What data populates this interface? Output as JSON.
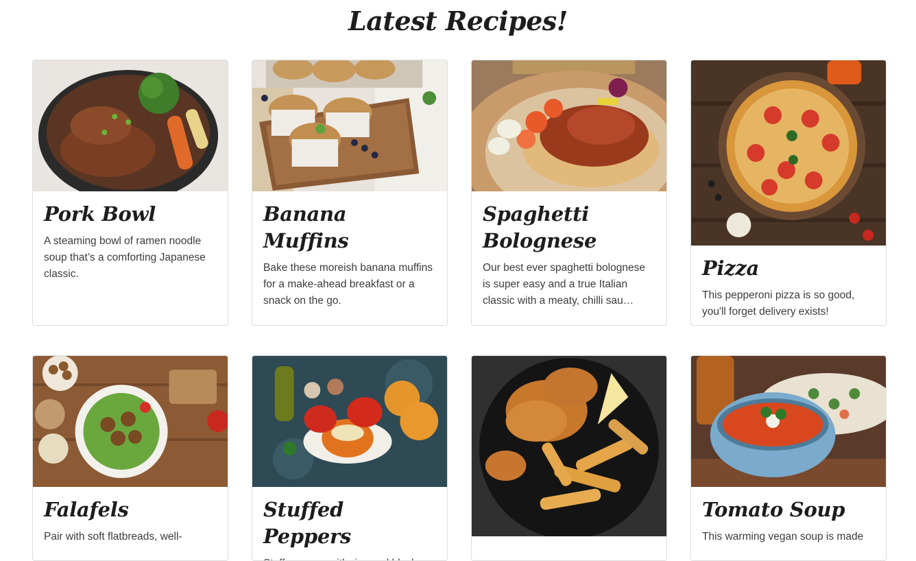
{
  "page": {
    "title": "Latest Recipes!"
  },
  "recipes": [
    {
      "title": "Pork Bowl",
      "description": "A steaming bowl of ramen noodle soup that’s a comforting Japanese classic.",
      "image": "pork-bowl-photo"
    },
    {
      "title": "Banana Muffins",
      "description": "Bake these moreish banana muffins for a make-ahead breakfast or a snack on the go.",
      "image": "banana-muffins-photo"
    },
    {
      "title": "Spaghetti Bolognese",
      "description": "Our best ever spaghetti bolognese is super easy and a true Italian classic with a meaty, chilli sau…",
      "image": "spaghetti-bolognese-photo"
    },
    {
      "title": "Pizza",
      "description": "This pepperoni pizza is so good, you'll forget delivery exists!",
      "image": "pizza-photo"
    },
    {
      "title": "Falafels",
      "description": "Pair with soft flatbreads, well-",
      "image": "falafels-photo"
    },
    {
      "title": "Stuffed Peppers",
      "description": "Stuff peppers with rice and black",
      "image": "stuffed-peppers-photo"
    },
    {
      "title": "",
      "description": "",
      "image": "fried-chicken-photo"
    },
    {
      "title": "Tomato Soup",
      "description": "This warming vegan soup is made",
      "image": "tomato-soup-photo"
    }
  ]
}
